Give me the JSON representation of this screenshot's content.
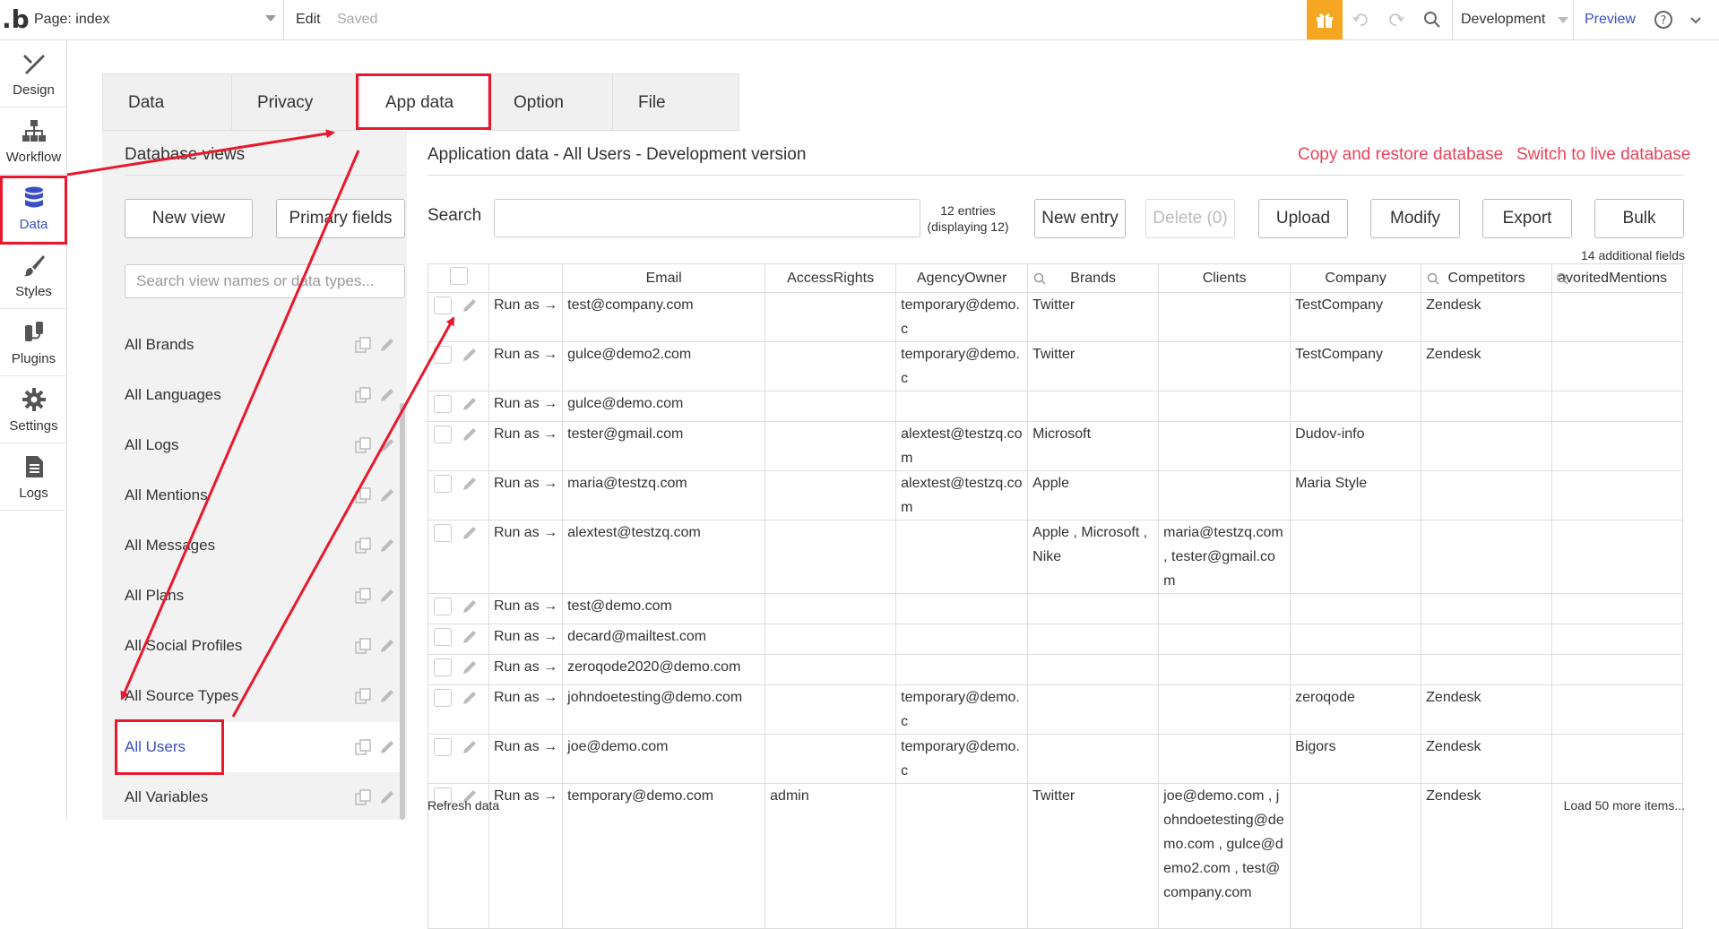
{
  "topbar": {
    "logo": ".b",
    "page_label": "Page: index",
    "edit": "Edit",
    "saved": "Saved",
    "environment": "Development",
    "preview": "Preview"
  },
  "leftnav": [
    {
      "label": "Design",
      "icon": "design-icon"
    },
    {
      "label": "Workflow",
      "icon": "workflow-icon"
    },
    {
      "label": "Data",
      "icon": "database-icon"
    },
    {
      "label": "Styles",
      "icon": "brush-icon"
    },
    {
      "label": "Plugins",
      "icon": "plug-icon"
    },
    {
      "label": "Settings",
      "icon": "gear-icon"
    },
    {
      "label": "Logs",
      "icon": "document-icon"
    }
  ],
  "tabs": [
    "Data types",
    "Privacy",
    "App data",
    "Option sets",
    "File manager"
  ],
  "views": {
    "title": "Database views",
    "new_view": "New view",
    "primary_fields": "Primary fields",
    "search_placeholder": "Search view names or data types...",
    "items": [
      "All Brands",
      "All Languages",
      "All Logs",
      "All Mentions",
      "All Messages",
      "All Plans",
      "All Social Profiles",
      "All Source Types",
      "All Users",
      "All Variables"
    ]
  },
  "main": {
    "title": "Application data - All Users - Development version",
    "copy_restore": "Copy and restore database",
    "switch_live": "Switch to live database",
    "search_label": "Search",
    "entries_line1": "12 entries",
    "entries_line2": "(displaying 12)",
    "new_entry": "New entry",
    "delete": "Delete (0)",
    "upload": "Upload",
    "modify": "Modify",
    "export": "Export",
    "bulk": "Bulk",
    "additional_fields": "14 additional fields",
    "refresh": "Refresh data",
    "load_more": "Load 50 more items..."
  },
  "table": {
    "run_as": "Run as →",
    "headers": [
      "Email",
      "AccessRights",
      "AgencyOwner",
      "Brands",
      "Clients",
      "Company",
      "Competitors",
      "avoritedMentions"
    ],
    "rows": [
      [
        "test@company.com",
        "",
        "temporary@demo.c",
        "Twitter",
        "",
        "TestCompany",
        "Zendesk",
        ""
      ],
      [
        "gulce@demo2.com",
        "",
        "temporary@demo.c",
        "Twitter",
        "",
        "TestCompany",
        "Zendesk",
        ""
      ],
      [
        "gulce@demo.com",
        "",
        "",
        "",
        "",
        "",
        "",
        ""
      ],
      [
        "tester@gmail.com",
        "",
        "alextest@testzq.com",
        "Microsoft",
        "",
        "Dudov-info",
        "",
        ""
      ],
      [
        "maria@testzq.com",
        "",
        "alextest@testzq.com",
        "Apple",
        "",
        "Maria Style",
        "",
        ""
      ],
      [
        "alextest@testzq.com",
        "",
        "",
        "Apple , Microsoft , Nike",
        "maria@testzq.com , tester@gmail.com",
        "",
        "",
        ""
      ],
      [
        "test@demo.com",
        "",
        "",
        "",
        "",
        "",
        "",
        ""
      ],
      [
        "decard@mailtest.com",
        "",
        "",
        "",
        "",
        "",
        "",
        ""
      ],
      [
        "zeroqode2020@demo.com",
        "",
        "",
        "",
        "",
        "",
        "",
        ""
      ],
      [
        "johndoetesting@demo.com",
        "",
        "temporary@demo.c",
        "",
        "",
        "zeroqode",
        "Zendesk",
        ""
      ],
      [
        "joe@demo.com",
        "",
        "temporary@demo.c",
        "",
        "",
        "Bigors",
        "Zendesk",
        ""
      ],
      [
        "temporary@demo.com",
        "admin",
        "",
        "Twitter",
        "joe@demo.com , johndoetesting@demo.com , gulce@demo2.com , test@company.com",
        "",
        "Zendesk",
        ""
      ]
    ]
  },
  "colors": {
    "accent": "#3b4fc4",
    "annotation": "#e8182d",
    "link_red": "#e8435a",
    "gift": "#f5a623"
  }
}
